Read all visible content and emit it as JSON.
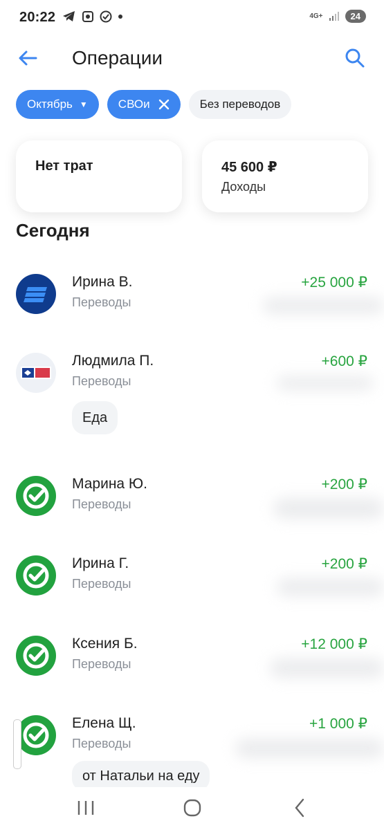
{
  "status_bar": {
    "time": "20:22",
    "network": "4G+",
    "battery": "24"
  },
  "header": {
    "title": "Операции"
  },
  "filters": [
    {
      "label": "Октябрь"
    },
    {
      "label": "СВОи"
    },
    {
      "label": "Без переводов"
    }
  ],
  "summary": {
    "expenses": {
      "label": "Нет трат"
    },
    "income": {
      "value": "45 600 ₽",
      "label": "Доходы"
    }
  },
  "section_title": "Сегодня",
  "operations": [
    {
      "name": "Ирина В.",
      "category": "Переводы",
      "amount": "+25 000 ₽"
    },
    {
      "name": "Людмила П.",
      "category": "Переводы",
      "amount": "+600 ₽",
      "tag": "Еда"
    },
    {
      "name": "Марина Ю.",
      "category": "Переводы",
      "amount": "+200 ₽"
    },
    {
      "name": "Ирина Г.",
      "category": "Переводы",
      "amount": "+200 ₽"
    },
    {
      "name": "Ксения Б.",
      "category": "Переводы",
      "amount": "+12 000 ₽"
    },
    {
      "name": "Елена Щ.",
      "category": "Переводы",
      "amount": "+1 000 ₽",
      "tag": "от Натальи на еду"
    }
  ],
  "colors": {
    "accent": "#3d86f0",
    "income": "#25a33d",
    "sber_green": "#22a23f"
  }
}
